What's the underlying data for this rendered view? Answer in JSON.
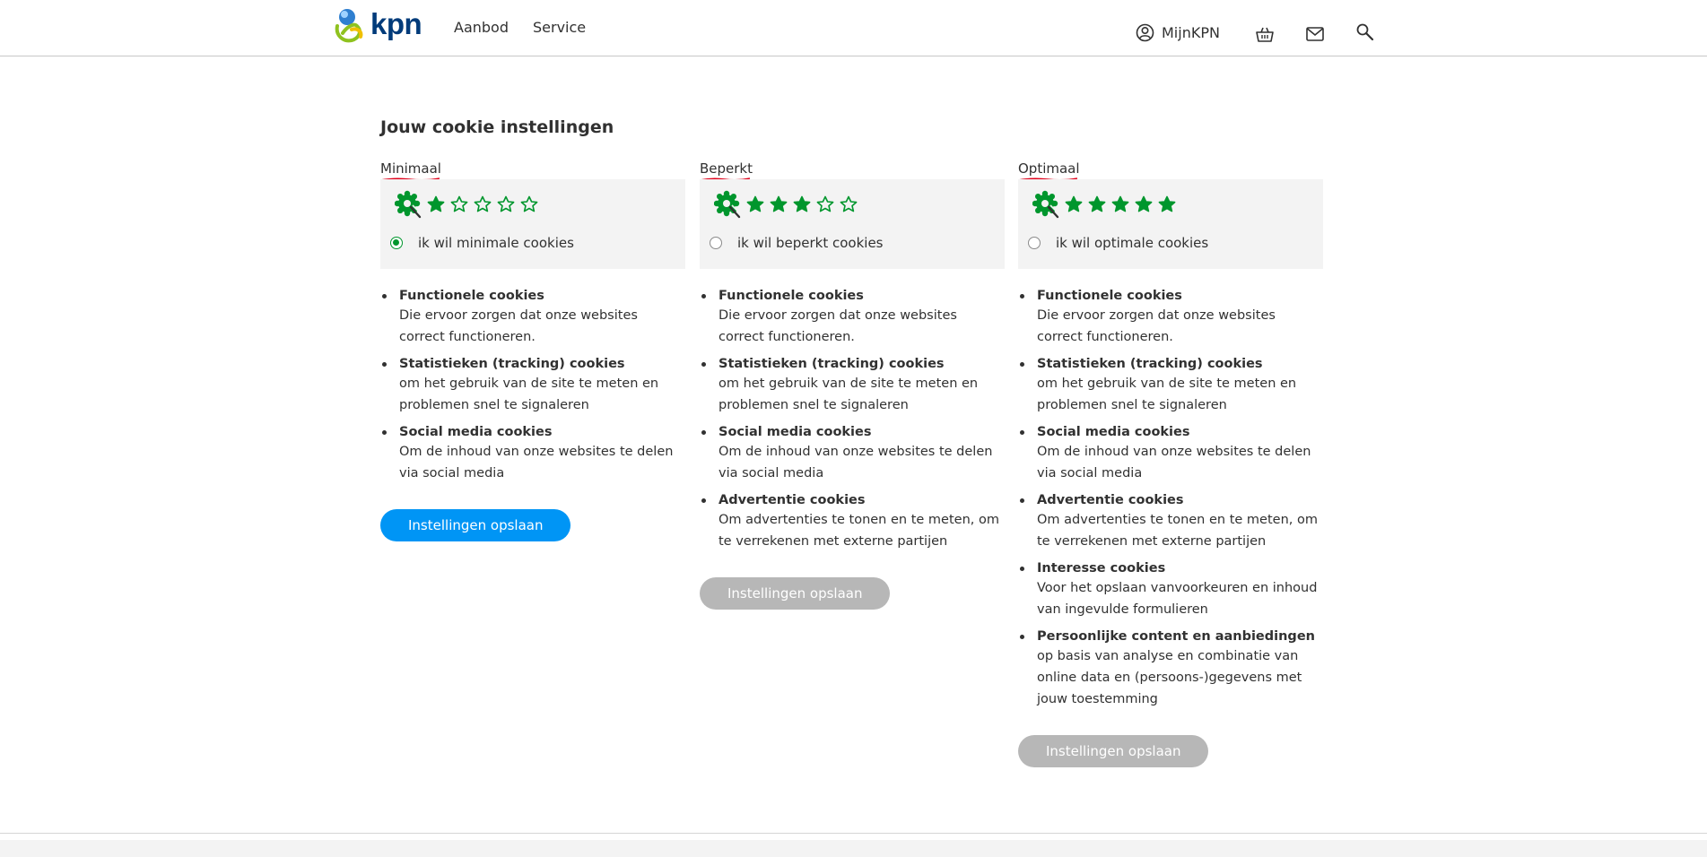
{
  "header": {
    "logo_text": "kpn",
    "nav": [
      "Aanbod",
      "Service"
    ],
    "account_label": "MijnKPN",
    "icons": [
      "user-circle-icon",
      "basket-icon",
      "mail-icon",
      "search-icon"
    ]
  },
  "page_title": "Jouw cookie instellingen",
  "colors": {
    "primary_button": "#0095f5",
    "disabled_button": "#b7b7b7",
    "green": "#00962d",
    "card_bg": "#f3f3f3",
    "squiggle": "#e0001a"
  },
  "levels": [
    {
      "name": "Minimaal",
      "rating": 1,
      "max_rating": 5,
      "radio_label": "ik wil minimale cookies",
      "selected": true,
      "features": [
        {
          "title": "Functionele cookies",
          "desc": "Die ervoor zorgen dat onze websites correct functioneren."
        },
        {
          "title": "Statistieken (tracking) cookies",
          "desc": "om het gebruik van de site te meten en problemen snel te signaleren"
        },
        {
          "title": "Social media cookies",
          "desc": "Om de inhoud van onze websites te delen via social media"
        }
      ],
      "button": "Instellingen opslaan",
      "button_enabled": true
    },
    {
      "name": "Beperkt",
      "rating": 3,
      "max_rating": 5,
      "radio_label": "ik wil beperkt cookies",
      "selected": false,
      "features": [
        {
          "title": "Functionele cookies",
          "desc": "Die ervoor zorgen dat onze websites correct functioneren."
        },
        {
          "title": "Statistieken (tracking) cookies",
          "desc": "om het gebruik van de site te meten en problemen snel te signaleren"
        },
        {
          "title": "Social media cookies",
          "desc": "Om de inhoud van onze websites te delen via social media"
        },
        {
          "title": "Advertentie cookies",
          "desc": "Om advertenties te tonen en te meten, om te verrekenen met externe partijen"
        }
      ],
      "button": "Instellingen opslaan",
      "button_enabled": false
    },
    {
      "name": "Optimaal",
      "rating": 5,
      "max_rating": 5,
      "radio_label": "ik wil optimale cookies",
      "selected": false,
      "features": [
        {
          "title": "Functionele cookies",
          "desc": "Die ervoor zorgen dat onze websites correct functioneren."
        },
        {
          "title": "Statistieken (tracking) cookies",
          "desc": "om het gebruik van de site te meten en problemen snel te signaleren"
        },
        {
          "title": "Social media cookies",
          "desc": "Om de inhoud van onze websites te delen via social media"
        },
        {
          "title": "Advertentie cookies",
          "desc": "Om advertenties te tonen en te meten, om te verrekenen met externe partijen"
        },
        {
          "title": "Interesse cookies",
          "desc": "Voor het opslaan vanvoorkeuren en inhoud van ingevulde formulieren"
        },
        {
          "title": "Persoonlijke content en aanbiedingen",
          "desc": "op basis van analyse en combinatie van online data en (persoons-)gegevens met jouw toestemming"
        }
      ],
      "button": "Instellingen opslaan",
      "button_enabled": false
    }
  ]
}
